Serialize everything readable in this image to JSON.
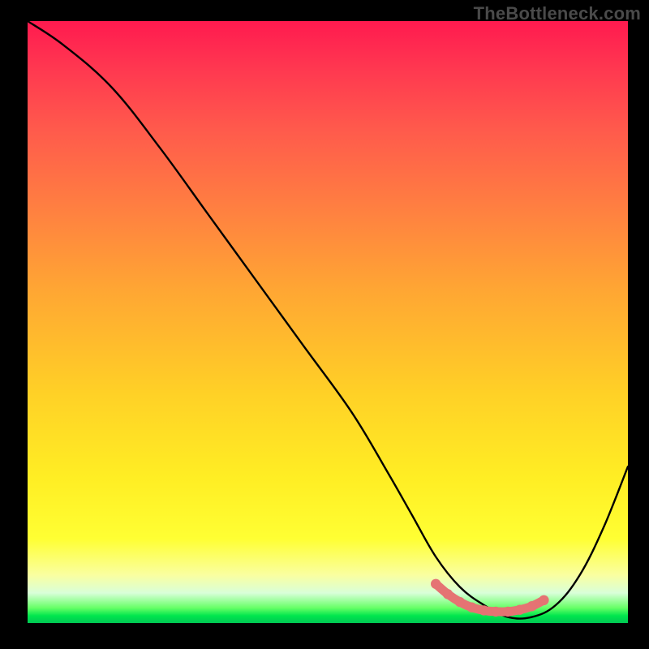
{
  "attribution": "TheBottleneck.com",
  "chart_data": {
    "type": "line",
    "title": "",
    "xlabel": "",
    "ylabel": "",
    "xlim": [
      0,
      100
    ],
    "ylim": [
      0,
      100
    ],
    "series": [
      {
        "name": "bottleneck-curve",
        "x": [
          0,
          6,
          14,
          22,
          30,
          38,
          46,
          54,
          60,
          64,
          68,
          72,
          76,
          80,
          84,
          88,
          92,
          96,
          100
        ],
        "y": [
          100,
          96,
          89,
          79,
          68,
          57,
          46,
          35,
          25,
          18,
          11,
          6,
          3,
          1,
          1,
          3,
          8,
          16,
          26
        ]
      },
      {
        "name": "optimal-range-highlight",
        "x": [
          68,
          70,
          72,
          74,
          76,
          78,
          80,
          82,
          84,
          86
        ],
        "y": [
          6.5,
          4.8,
          3.5,
          2.6,
          2.1,
          1.9,
          1.9,
          2.2,
          2.8,
          3.8
        ]
      }
    ],
    "colors": {
      "curve": "#000000",
      "highlight": "#e57373",
      "gradient_top": "#ff1a4f",
      "gradient_mid": "#ffd126",
      "gradient_bottom": "#00c853"
    }
  }
}
